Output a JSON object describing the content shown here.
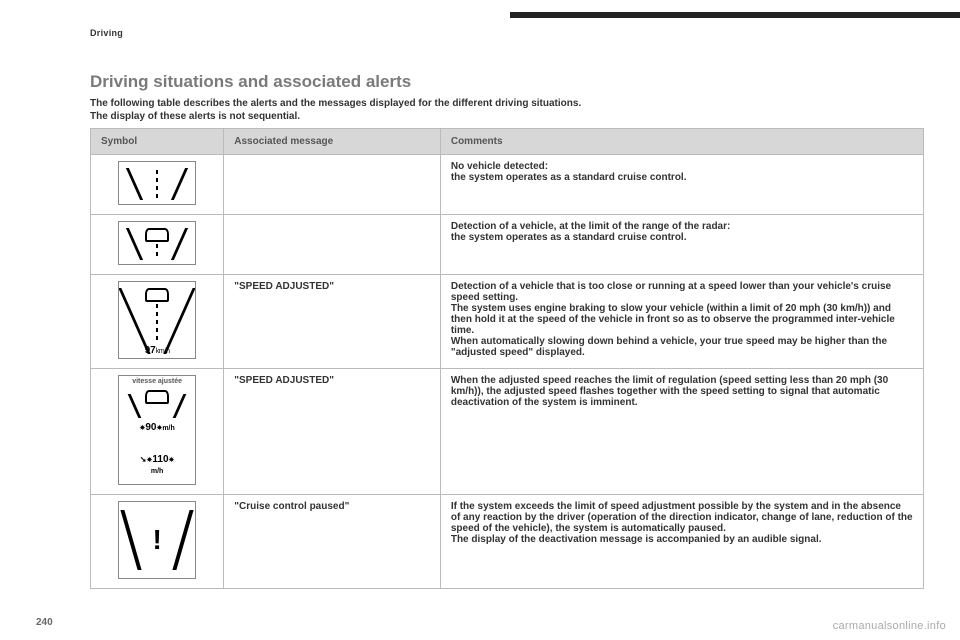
{
  "header": {
    "section_label": "Driving"
  },
  "title": "Driving situations and associated alerts",
  "intro_line1": "The following table describes the alerts and the messages displayed for the different driving situations.",
  "intro_line2": "The display of these alerts is not sequential.",
  "columns": {
    "symbol": "Symbol",
    "associated_message": "Associated message",
    "comments": "Comments"
  },
  "rows": [
    {
      "message": "",
      "comments": "No vehicle detected:\nthe system operates as a standard cruise control.",
      "symbol": {
        "kind": "lane-empty"
      }
    },
    {
      "message": "",
      "comments": "Detection of a vehicle, at the limit of the range of the radar:\nthe system operates as a standard cruise control.",
      "symbol": {
        "kind": "lane-car"
      }
    },
    {
      "message": "\"SPEED ADJUSTED\"",
      "comments": "Detection of a vehicle that is too close or running at a speed lower than your vehicle's cruise speed setting.\nThe system uses engine braking to slow your vehicle (within a limit of 20 mph (30 km/h)) and then hold it at the speed of the vehicle in front so as to observe the programmed inter-vehicle time.\nWhen automatically slowing down behind a vehicle, your true speed may be higher than the \"adjusted speed\" displayed.",
      "symbol": {
        "kind": "lane-car-97",
        "readout": "97",
        "readout_unit": "km/h"
      }
    },
    {
      "message": "\"SPEED ADJUSTED\"",
      "comments": "When the adjusted speed reaches the limit of regulation (speed setting less than 20 mph (30 km/h)), the adjusted speed flashes together with the speed setting to signal that automatic deactivation of the system is imminent.",
      "symbol": {
        "kind": "vitesse-flash",
        "label": "vitesse ajustée",
        "speed1": "90",
        "speed2": "110",
        "unit": "m/h"
      }
    },
    {
      "message": "\"Cruise control paused\"",
      "comments": "If the system exceeds the limit of speed adjustment possible by the system and in the absence of any reaction by the driver (operation of the direction indicator, change of lane, reduction of the speed of the vehicle), the system is automatically paused.\nThe display of the deactivation message is accompanied by an audible signal.",
      "symbol": {
        "kind": "exclaim"
      }
    }
  ],
  "footer": {
    "page_number": "240",
    "watermark": "carmanualsonline.info"
  }
}
